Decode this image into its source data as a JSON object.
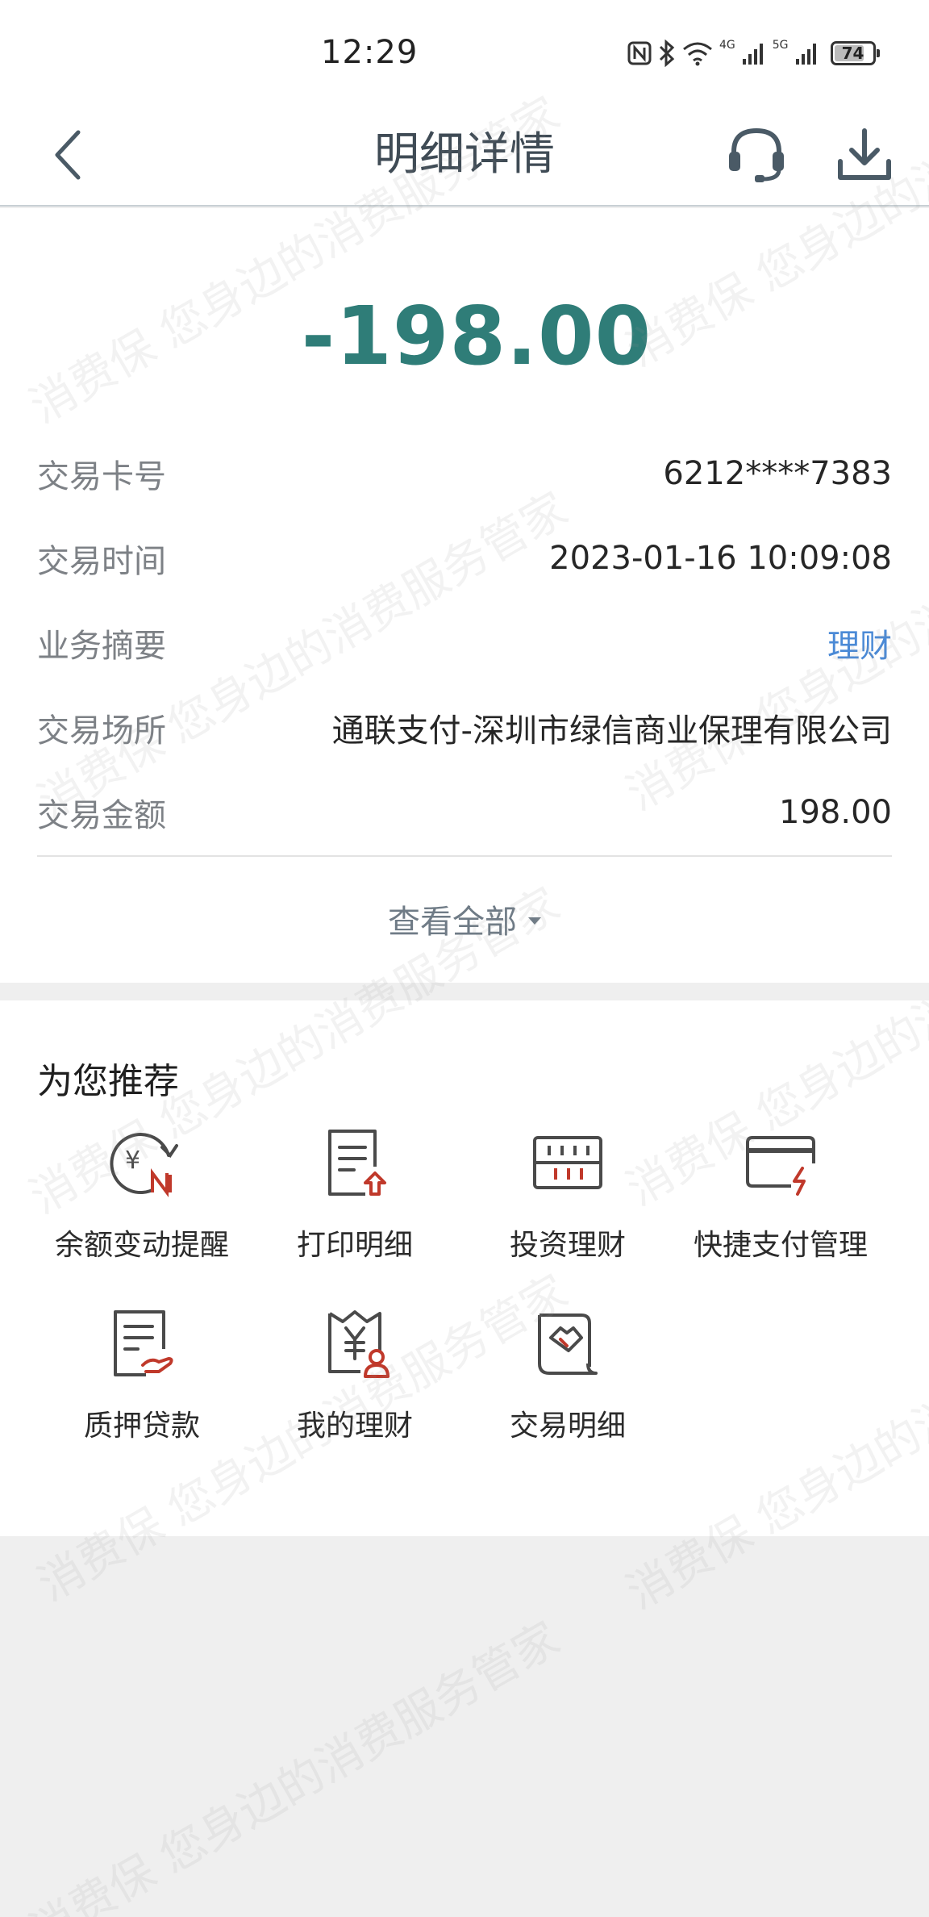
{
  "status_bar": {
    "time": "12:29",
    "network_a": "4G",
    "network_b": "5G",
    "battery": "74",
    "icons": [
      "nfc-icon",
      "bluetooth-icon",
      "wifi-icon",
      "signal-icon",
      "battery-icon"
    ]
  },
  "header": {
    "title": "明细详情",
    "icons": [
      "back-arrow-icon",
      "headset-icon",
      "download-icon"
    ]
  },
  "transaction": {
    "amount": "-198.00",
    "rows": [
      {
        "label": "交易卡号",
        "value": "6212****7383"
      },
      {
        "label": "交易时间",
        "value": "2023-01-16 10:09:08"
      },
      {
        "label": "业务摘要",
        "value": "理财"
      },
      {
        "label": "交易场所",
        "value": "通联支付-深圳市绿信商业保理有限公司"
      },
      {
        "label": "交易金额",
        "value": "198.00"
      }
    ],
    "view_all": "查看全部"
  },
  "recommend": {
    "title": "为您推荐",
    "items": [
      {
        "label": "余额变动提醒",
        "icon": "balance-alert-icon"
      },
      {
        "label": "打印明细",
        "icon": "print-detail-icon"
      },
      {
        "label": "投资理财",
        "icon": "abacus-icon"
      },
      {
        "label": "快捷支付管理",
        "icon": "card-payment-icon"
      },
      {
        "label": "质押贷款",
        "icon": "pledge-loan-icon"
      },
      {
        "label": "我的理财",
        "icon": "my-wealth-icon"
      },
      {
        "label": "交易明细",
        "icon": "transaction-detail-icon"
      }
    ]
  },
  "watermark": {
    "text": "消费保 您身边的消费服务管家"
  },
  "colors": {
    "amount": "#2f7d78",
    "link": "#4b8ad6",
    "icon_red": "#c0392b",
    "icon_dark": "#4a4a4a"
  }
}
